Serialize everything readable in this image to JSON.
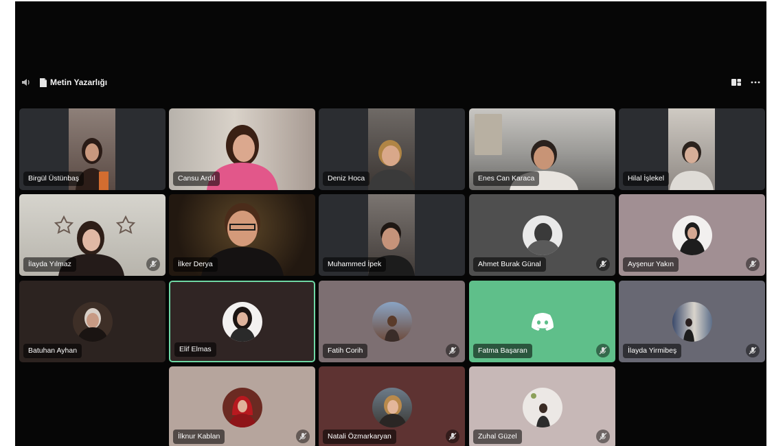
{
  "channel": {
    "title": "Metin Yazarlığı"
  },
  "toolbar": {
    "layout_icon": "grid-layout-icon",
    "more_icon": "more-options-icon"
  },
  "colors": {
    "stage": "#060606",
    "speaking_border": "#6fd8a4",
    "discord_green": "#5fbf8a",
    "tile_dark": "#2b2d31"
  },
  "participants": [
    {
      "name": "Birgül Üstünbaş",
      "type": "camera",
      "muted": false
    },
    {
      "name": "Cansu Ardıl",
      "type": "camera",
      "muted": false
    },
    {
      "name": "Deniz Hoca",
      "type": "camera",
      "muted": false
    },
    {
      "name": "Enes Can Karaca",
      "type": "camera",
      "muted": false
    },
    {
      "name": "Hilal İşlekel",
      "type": "camera",
      "muted": false
    },
    {
      "name": "İlayda Yılmaz",
      "type": "camera",
      "muted": true
    },
    {
      "name": "İlker Derya",
      "type": "camera",
      "muted": false
    },
    {
      "name": "Muhammed İpek",
      "type": "camera",
      "muted": false
    },
    {
      "name": "Ahmet Burak Günal",
      "type": "avatar",
      "muted": true,
      "tile_color": "#4f4f4f"
    },
    {
      "name": "Ayşenur Yakın",
      "type": "avatar",
      "muted": true,
      "tile_color": "#a18f93"
    },
    {
      "name": "Batuhan Ayhan",
      "type": "avatar",
      "muted": false,
      "tile_color": "#2c2320"
    },
    {
      "name": "Elif Elmas",
      "type": "avatar",
      "muted": false,
      "speaking": true,
      "tile_color": "#302524"
    },
    {
      "name": "Fatih Corih",
      "type": "avatar",
      "muted": true,
      "tile_color": "#7d6f72"
    },
    {
      "name": "Fatma Başaran",
      "type": "avatar",
      "muted": true,
      "tile_color": "#5fbf8a"
    },
    {
      "name": "İlayda Yirmibeş",
      "type": "avatar",
      "muted": true,
      "tile_color": "#686873"
    },
    {
      "name": "İlknur Kablan",
      "type": "avatar",
      "muted": true,
      "tile_color": "#b6a59d"
    },
    {
      "name": "Natali Özmarkaryan",
      "type": "avatar",
      "muted": true,
      "tile_color": "#5e3332"
    },
    {
      "name": "Zuhal Güzel",
      "type": "avatar",
      "muted": true,
      "tile_color": "#c7b8b7"
    }
  ]
}
